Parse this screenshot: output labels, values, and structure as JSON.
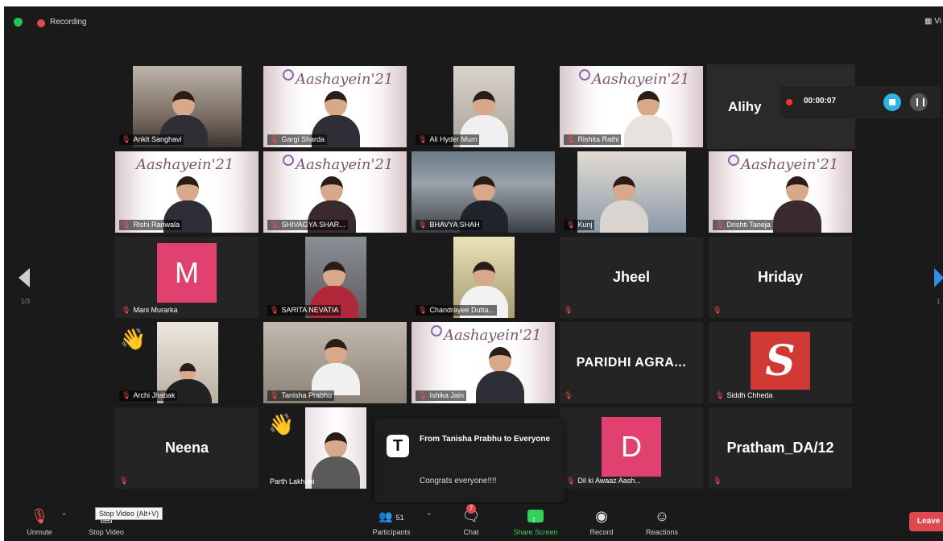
{
  "topbar": {
    "recording_label": "Recording",
    "view_label": "Vi"
  },
  "nav": {
    "page_indicator": "1/3",
    "page_indicator_right": "1"
  },
  "recording": {
    "time": "00:00:07"
  },
  "tiles": {
    "r1c1": "Ankit Sanghavi",
    "r1c2": "Gargi Sharda",
    "r1c3": "Ali Hyder Mum",
    "r1c4": "Rishita Rathi",
    "r1c5": "Alihy",
    "r2c1": "Rishi Rariwala",
    "r2c2": "SHIVAGYA SHAR...",
    "r2c3": "BHAVYA SHAH",
    "r2c4": "Kunj",
    "r2c5": "Drishti Taneja",
    "r3c1": "Mani Murarka",
    "r3c1_avatar": "M",
    "r3c2": "SARITA NEVATIA",
    "r3c3": "Chandrayee Dutta...",
    "r3c4": "Jheel",
    "r3c5": "Hriday",
    "r4c1": "Archi Jhabak",
    "r4c2": "Tanisha Prabhu",
    "r4c3": "Ishika Jain",
    "r4c4": "PARIDHI AGRA...",
    "r4c5": "Siddh Chheda",
    "r4c5_logo": "S",
    "r5c1": "Neena",
    "r5c2": "Parth Lakhani",
    "r5c4": "Dil ki Awaaz Aash...",
    "r5c4_avatar": "D",
    "r5c5": "Pratham_DA/12"
  },
  "banner": {
    "text": "Aashayein'21"
  },
  "chat_popup": {
    "avatar": "T",
    "from": "From Tanisha Prabhu to Everyone",
    "message": "Congrats everyone!!!!"
  },
  "tooltip": "Stop Video (Alt+V)",
  "toolbar": {
    "unmute": "Unmute",
    "stop_video": "Stop Video",
    "participants": "Participants",
    "participants_count": "51",
    "chat": "Chat",
    "chat_badge": "7",
    "share_screen": "Share Screen",
    "record": "Record",
    "reactions": "Reactions",
    "leave": "Leave"
  },
  "colors": {
    "recording": "#e0484f",
    "active_speaker": "#c7e86e",
    "share_green": "#2fd35a",
    "avatar_pink": "#e0416e"
  }
}
